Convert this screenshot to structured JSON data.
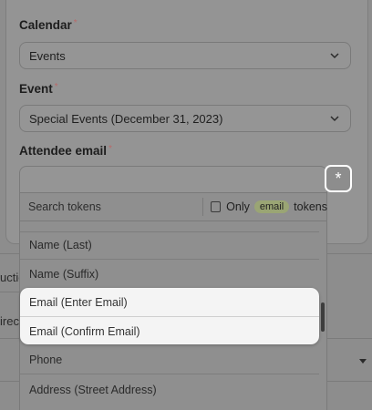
{
  "form": {
    "calendar_label": "Calendar",
    "calendar_value": "Events",
    "event_label": "Event",
    "event_value": "Special Events (December 31, 2023)",
    "attendee_label": "Attendee email",
    "required_mark": "*",
    "insert_token_symbol": "*"
  },
  "background": {
    "left_snippet_1": "uctio",
    "left_snippet_2": "irect"
  },
  "token_picker": {
    "search_placeholder": "Search tokens",
    "only_label": "Only",
    "filter_pill": "email",
    "tokens_label": "tokens",
    "options": [
      "Name (Last)",
      "Name (Suffix)",
      "Email (Enter Email)",
      "Email (Confirm Email)",
      "Phone",
      "Address (Street Address)"
    ]
  },
  "colors": {
    "highlight_bg": "#f4f4f4",
    "pill_bg": "#9aa574"
  }
}
